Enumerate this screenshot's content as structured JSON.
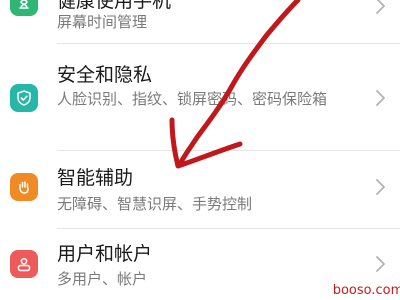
{
  "settings": {
    "items": [
      {
        "title": "健康使用手机",
        "subtitle": "屏幕时间管理",
        "icon": "hourglass-icon",
        "icon_color": "#2fb574"
      },
      {
        "title": "安全和隐私",
        "subtitle": "人脸识别、指纹、锁屏密码、密码保险箱",
        "icon": "shield-check-icon",
        "icon_color": "#26b7a9"
      },
      {
        "title": "智能辅助",
        "subtitle": "无障碍、智慧识屏、手势控制",
        "icon": "hand-icon",
        "icon_color": "#f08a25"
      },
      {
        "title": "用户和帐户",
        "subtitle": "多用户、帐户",
        "icon": "user-account-icon",
        "icon_color": "#ee5a5a"
      }
    ]
  },
  "watermark": {
    "text": "booso.com"
  },
  "annotation": {
    "color": "#c0181b",
    "type": "hand-drawn arrow"
  }
}
